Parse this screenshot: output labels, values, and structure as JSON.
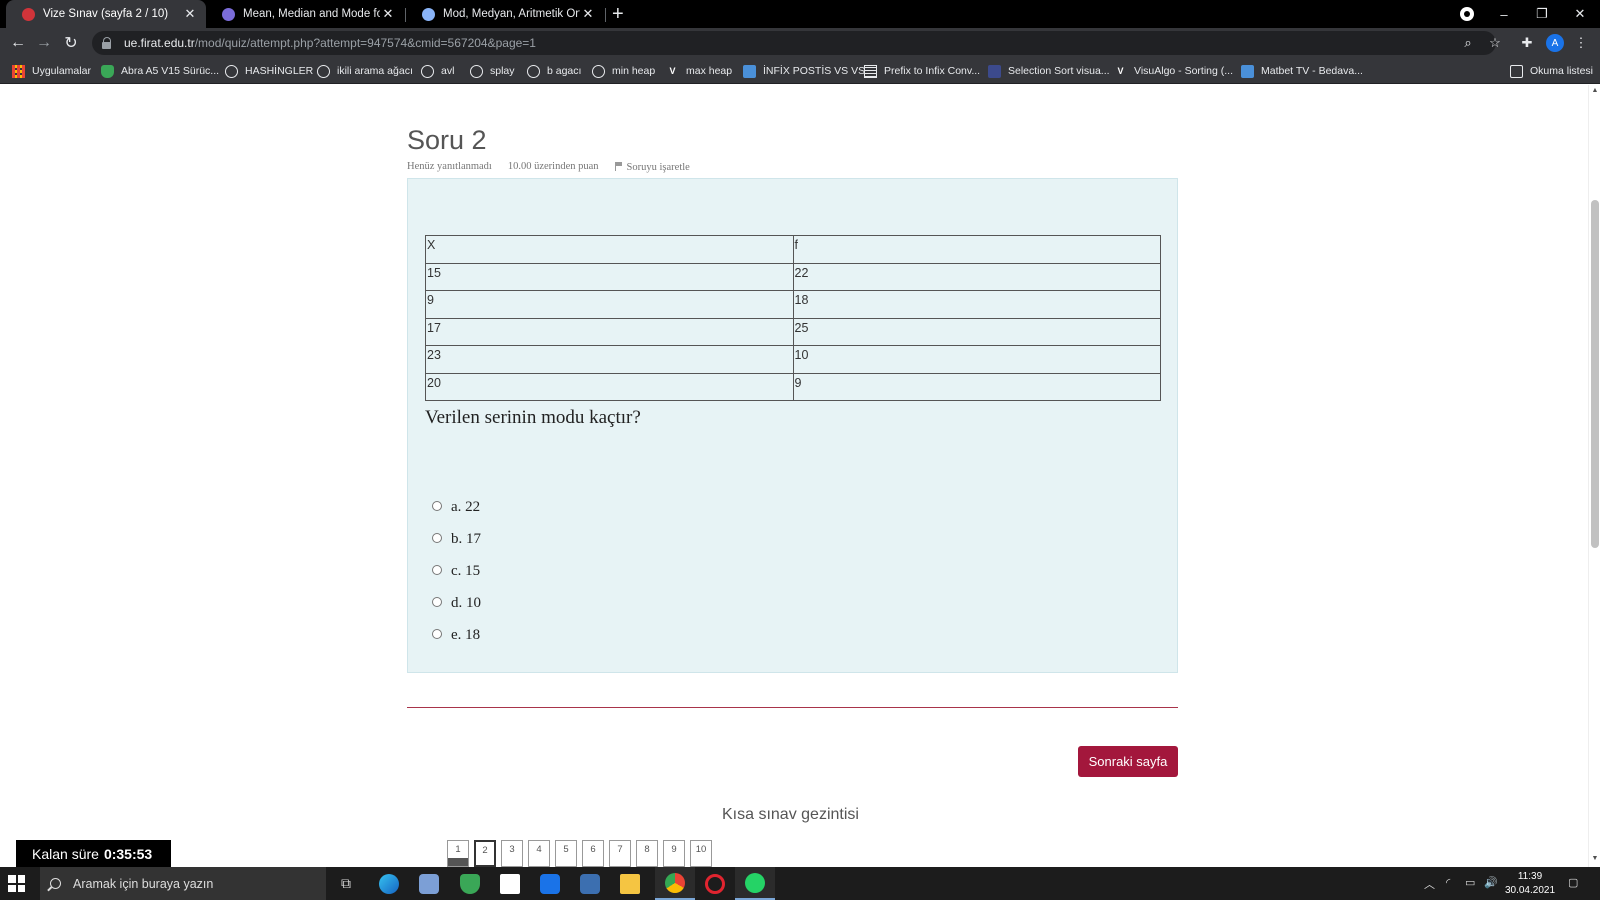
{
  "browser": {
    "tabs": [
      {
        "title": "Vize Sınav (sayfa 2 / 10)",
        "active": true,
        "favicon_color": "#d0343a"
      },
      {
        "title": "Mean, Median and Mode for ungro",
        "active": false,
        "favicon_color": "#7b6cd9"
      },
      {
        "title": "Mod, Medyan, Aritmetik Ortalam",
        "active": false,
        "favicon_color": "#8ab4f8"
      }
    ],
    "new_tab_symbol": "+",
    "url_host": "ue.firat.edu.tr",
    "url_path": "/mod/quiz/attempt.php?attempt=947574&cmid=567204&page=1",
    "profile_initial": "A",
    "bookmarks": [
      {
        "label": "Uygulamalar",
        "icon": "apps-icon"
      },
      {
        "label": "Abra A5 V15 Sürüc...",
        "icon": "shield-icon"
      },
      {
        "label": "HASHİNGLER",
        "icon": "globe-icon"
      },
      {
        "label": "ikili arama ağacı",
        "icon": "globe-icon"
      },
      {
        "label": "avl",
        "icon": "globe-icon"
      },
      {
        "label": "splay",
        "icon": "globe-icon"
      },
      {
        "label": "b agacı",
        "icon": "globe-icon"
      },
      {
        "label": "min heap",
        "icon": "globe-icon"
      },
      {
        "label": "max heap",
        "icon": "visualgo-icon"
      },
      {
        "label": "İNFİX POSTİS VS VS",
        "icon": "picture-icon"
      },
      {
        "label": "Prefix to Infix Conv...",
        "icon": "grid-icon"
      },
      {
        "label": "Selection Sort visua...",
        "icon": "box-icon"
      },
      {
        "label": "VisuAlgo - Sorting (...",
        "icon": "visualgo-icon"
      },
      {
        "label": "Matbet TV - Bedava...",
        "icon": "picture-icon"
      }
    ],
    "reading_list": "Okuma listesi"
  },
  "question": {
    "title": "Soru 2",
    "status": "Henüz yanıtlanmadı",
    "points": "10.00 üzerinden puan",
    "flag_label": "Soruyu işaretle",
    "table_header": [
      "X",
      "f"
    ],
    "table_rows": [
      [
        "15",
        "22"
      ],
      [
        "9",
        "18"
      ],
      [
        "17",
        "25"
      ],
      [
        "23",
        "10"
      ],
      [
        "20",
        "9"
      ]
    ],
    "text": "Verilen serinin modu kaçtır?",
    "options": [
      "a. 22",
      "b. 17",
      "c. 15",
      "d. 10",
      "e. 18"
    ]
  },
  "next_button": "Sonraki sayfa",
  "quiz_nav": {
    "title": "Kısa sınav gezintisi",
    "pages": [
      "1",
      "2",
      "3",
      "4",
      "5",
      "6",
      "7",
      "8",
      "9",
      "10"
    ],
    "current_page": 2
  },
  "timer": {
    "label": "Kalan süre",
    "value": "0:35:53"
  },
  "taskbar": {
    "search_placeholder": "Aramak için buraya yazın",
    "time": "11:39",
    "date": "30.04.2021"
  },
  "colors": {
    "accent": "#a3173c",
    "question_bg": "#e7f3f5"
  }
}
